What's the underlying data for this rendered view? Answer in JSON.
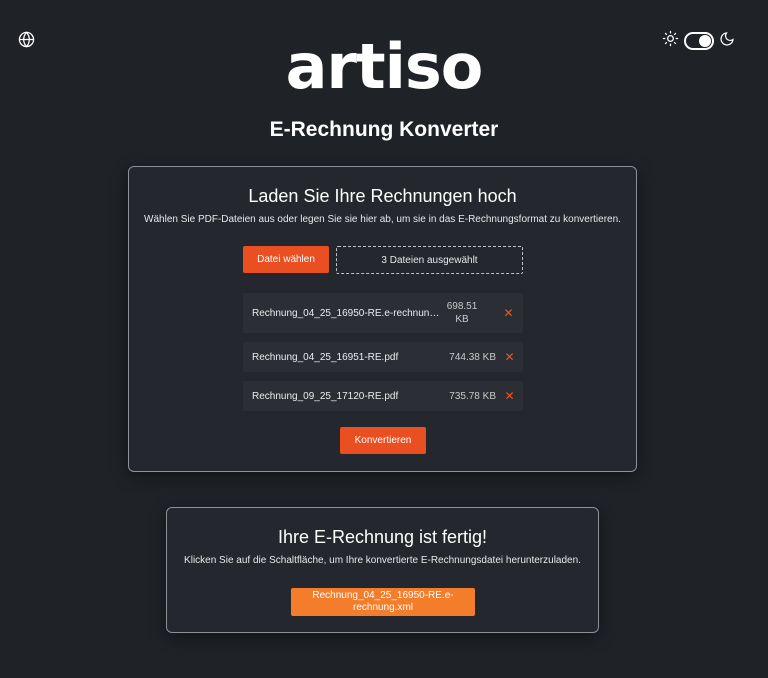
{
  "header": {
    "logo_text": "artiso",
    "title": "E-Rechnung Konverter",
    "language_icon": "globe-icon",
    "theme_icons": [
      "sun-icon",
      "moon-icon"
    ],
    "dark_mode": true
  },
  "upload": {
    "heading": "Laden Sie Ihre Rechnungen hoch",
    "description": "Wählen Sie PDF-Dateien aus oder legen Sie sie hier ab, um sie in das E-Rechnungsformat zu konvertieren.",
    "choose_label": "Datei wählen",
    "selected_label": "3 Dateien ausgewählt",
    "files": [
      {
        "name": "Rechnung_04_25_16950-RE.e-rechnung.xml",
        "size": "698.51 KB"
      },
      {
        "name": "Rechnung_04_25_16951-RE.pdf",
        "size": "744.38 KB"
      },
      {
        "name": "Rechnung_09_25_17120-RE.pdf",
        "size": "735.78 KB"
      }
    ],
    "remove_symbol": "✕",
    "convert_label": "Konvertieren"
  },
  "result": {
    "heading": "Ihre E-Rechnung ist fertig!",
    "description": "Klicken Sie auf die Schaltfläche, um Ihre konvertierte E-Rechnungsdatei herunterzuladen.",
    "download_label": "Rechnung_04_25_16950-RE.e-rechnung.xml"
  },
  "colors": {
    "background": "#1f2227",
    "card": "#24272d",
    "accent": "#ea4f21",
    "download": "#f47d2c",
    "remove": "#e4572e"
  }
}
